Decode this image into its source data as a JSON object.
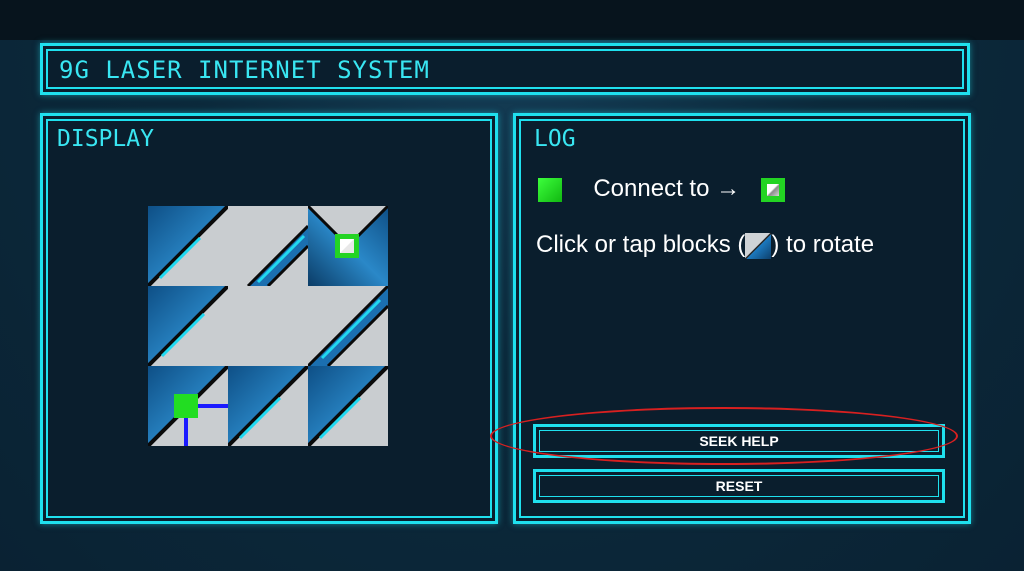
{
  "header": {
    "title": "9G LASER INTERNET SYSTEM"
  },
  "display": {
    "heading": "DISPLAY",
    "tiles": [
      {
        "row": 0,
        "col": 0,
        "kind": "diag-corner"
      },
      {
        "row": 0,
        "col": 1,
        "kind": "diag-stripe"
      },
      {
        "row": 0,
        "col": 2,
        "kind": "target"
      },
      {
        "row": 1,
        "col": 0,
        "kind": "diag-corner"
      },
      {
        "row": 1,
        "col": 1,
        "kind": "plain"
      },
      {
        "row": 1,
        "col": 2,
        "kind": "diag-stripe"
      },
      {
        "row": 2,
        "col": 0,
        "kind": "source"
      },
      {
        "row": 2,
        "col": 1,
        "kind": "diag-corner"
      },
      {
        "row": 2,
        "col": 2,
        "kind": "diag-corner"
      }
    ],
    "colors": {
      "laser": "#1a1aff",
      "source": "#22dd22",
      "tile_light": "#c9cdd0",
      "tile_blue": "#1b6fb0"
    }
  },
  "log": {
    "heading": "LOG",
    "connect_text": "Connect to →",
    "instruction_before": "Click or tap blocks (",
    "instruction_after": ") to rotate"
  },
  "buttons": {
    "seek_help": "SEEK HELP",
    "reset": "RESET"
  },
  "accent_color": "#1fe0ee",
  "highlight_color": "#d82020"
}
